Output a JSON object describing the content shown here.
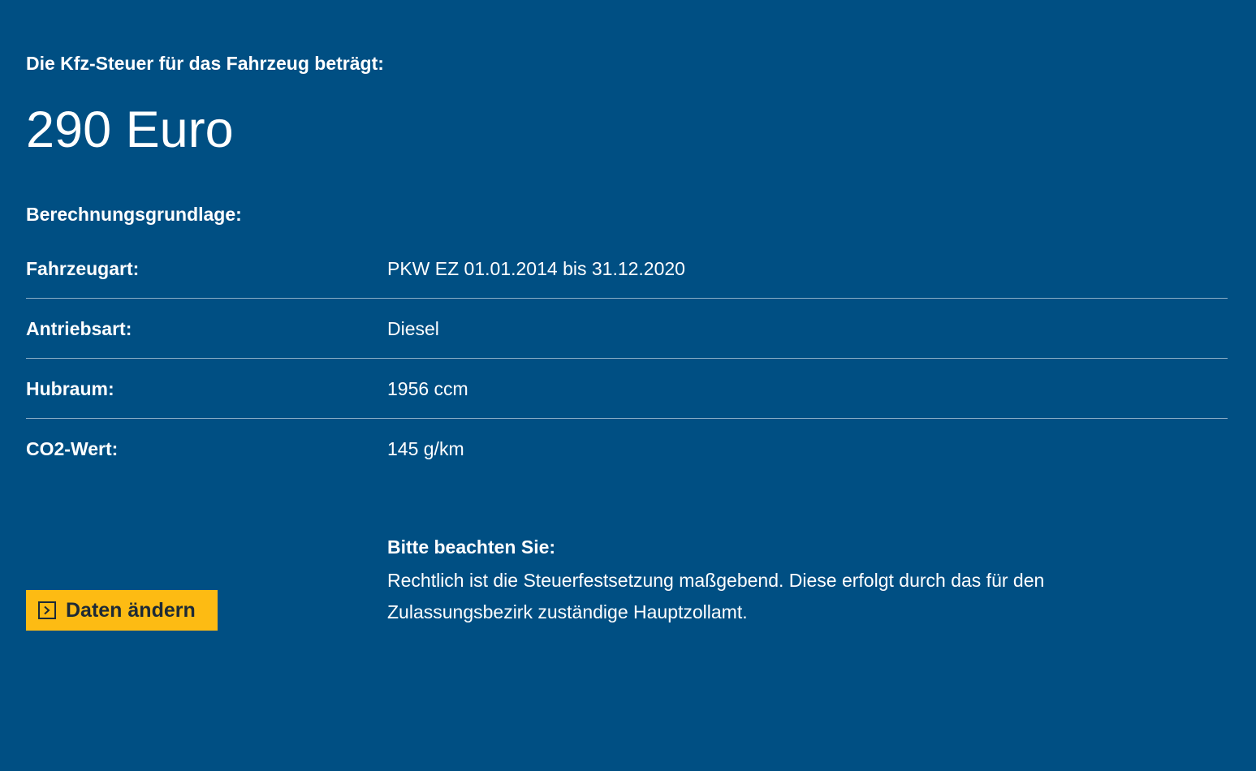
{
  "result": {
    "intro": "Die Kfz-Steuer für das Fahrzeug beträgt:",
    "amount": "290 Euro",
    "basis_heading": "Berechnungsgrundlage:"
  },
  "details": [
    {
      "label": "Fahrzeugart:",
      "value": "PKW EZ 01.01.2014 bis 31.12.2020"
    },
    {
      "label": "Antriebsart:",
      "value": "Diesel"
    },
    {
      "label": "Hubraum:",
      "value": "1956 ccm"
    },
    {
      "label": "CO2-Wert:",
      "value": "145 g/km"
    }
  ],
  "actions": {
    "change_data_label": "Daten ändern",
    "change_data_icon": "chevron-right-box-icon"
  },
  "notice": {
    "title": "Bitte beachten Sie:",
    "text": "Rechtlich ist die Steuerfestsetzung maßgebend. Diese erfolgt durch das für den Zulassungsbezirk zuständige Hauptzollamt."
  },
  "colors": {
    "background": "#004f83",
    "text": "#ffffff",
    "button": "#fdbb13",
    "button_text": "#1d2a36"
  }
}
